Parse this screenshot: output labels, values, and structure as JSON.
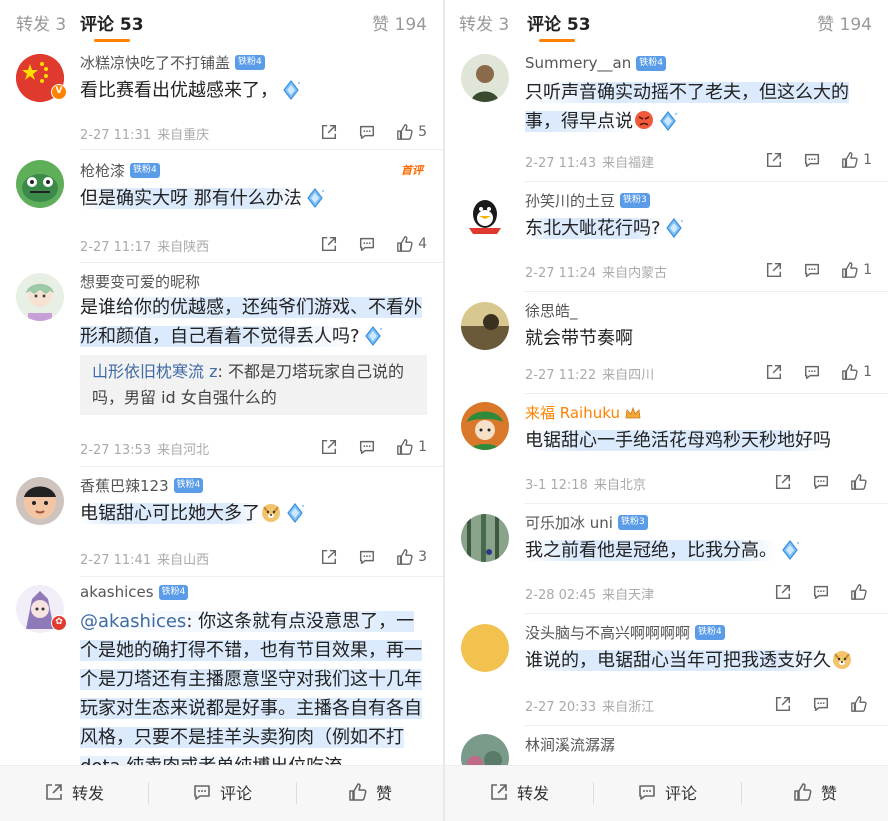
{
  "left": {
    "tabs": {
      "reposts": "转发 3",
      "comments": "评论 53",
      "likes_label": "赞",
      "likes_count": "194"
    },
    "comments": [
      {
        "name": "冰糕凉快吃了不打铺盖",
        "fan": "铁粉4",
        "text": "看比赛看出优越感来了，",
        "time": "2-27 11:31",
        "loc": "来自重庆",
        "like": "5",
        "avatar_color": "#e03a2e"
      },
      {
        "name": "枪枪漆",
        "fan": "铁粉4",
        "text": "但是确实大呀 那有什么办法",
        "time": "2-27 11:17",
        "loc": "来自陕西",
        "like": "4",
        "tag": "首评",
        "avatar_color": "#3c8a4a"
      },
      {
        "name": "想要变可爱的昵称",
        "text": "是谁给你的优越感，还纯爷们游戏、不看外形和颜值，自己看着不觉得丢人吗?",
        "reply_name": "山形依旧枕寒流 z",
        "reply_text": ": 不都是刀塔玩家自己说的吗，男留 id 女自强什么的",
        "time": "2-27 13:53",
        "loc": "来自河北",
        "like": "1",
        "avatar_color": "#b7d4b9"
      },
      {
        "name": "香蕉巴辣123",
        "fan": "铁粉4",
        "text": "电锯甜心可比她大多了",
        "time": "2-27 11:41",
        "loc": "来自山西",
        "like": "3",
        "avatar_color": "#d9a07c"
      },
      {
        "name": "akashices",
        "fan": "铁粉4",
        "mention": "@akashices",
        "text": ": 你这条就有点没意思了，一个是她的确打得不错，也有节目效果，再一个是刀塔还有主播愿意坚守对我们这十几年玩家对生态来说都是好事。主播各自有各自风格，只要不是挂羊头卖狗肉（例如不打 dota 纯卖肉或者单纯博出位吃流",
        "avatar_color": "#8e7ab8"
      }
    ],
    "bottom": {
      "repost": "转发",
      "comment": "评论",
      "like": "赞"
    }
  },
  "right": {
    "tabs": {
      "reposts": "转发 3",
      "comments": "评论 53",
      "likes_label": "赞",
      "likes_count": "194"
    },
    "comments": [
      {
        "name": "Summery__an",
        "fan": "铁粉4",
        "text": "只听声音确实动摇不了老夫，但这么大的事，得早点说",
        "time": "2-27 11:43",
        "loc": "来自福建",
        "like": "1",
        "avatar_color": "#4a5a3e"
      },
      {
        "name": "孙笑川的土豆",
        "fan": "铁粉3",
        "text": "东北大呲花行吗?",
        "time": "2-27 11:24",
        "loc": "来自内蒙古",
        "like": "1",
        "avatar_color": "#2b2b2b"
      },
      {
        "name": "徐思皓_",
        "text": "就会带节奏啊",
        "time": "2-27 11:22",
        "loc": "来自四川",
        "like": "1",
        "avatar_color": "#a08a4a"
      },
      {
        "name": "来福 Raihuku",
        "text": "电锯甜心一手绝活花母鸡秒天秒地好吗",
        "time": "3-1 12:18",
        "loc": "来自北京",
        "like": "",
        "avatar_color": "#2f8a3a"
      },
      {
        "name": "可乐加冰 uni",
        "fan": "铁粉3",
        "text": "我之前看他是冠绝，比我分高。",
        "time": "2-28 02:45",
        "loc": "来自天津",
        "like": "",
        "avatar_color": "#3d5a40"
      },
      {
        "name": "没头脑与不高兴啊啊啊啊",
        "fan": "铁粉4",
        "text": "谁说的，电锯甜心当年可把我透支好久",
        "time": "2-27 20:33",
        "loc": "来自浙江",
        "like": "",
        "avatar_color": "#f2c14e"
      },
      {
        "name": "林涧溪流潺潺",
        "avatar_color": "#5a7a6a"
      }
    ],
    "bottom": {
      "repost": "转发",
      "comment": "评论",
      "like": "赞"
    }
  },
  "icons": {
    "share": "share-icon",
    "comment": "comment-icon",
    "like": "thumbs-up-icon",
    "diamond": "diamond-sticker-icon",
    "dog": "doge-emoji-icon",
    "angry": "angry-emoji-icon"
  },
  "colors": {
    "accent": "#ff8200",
    "link": "#3e6aa5",
    "fan_badge": "#5a9ce8"
  }
}
